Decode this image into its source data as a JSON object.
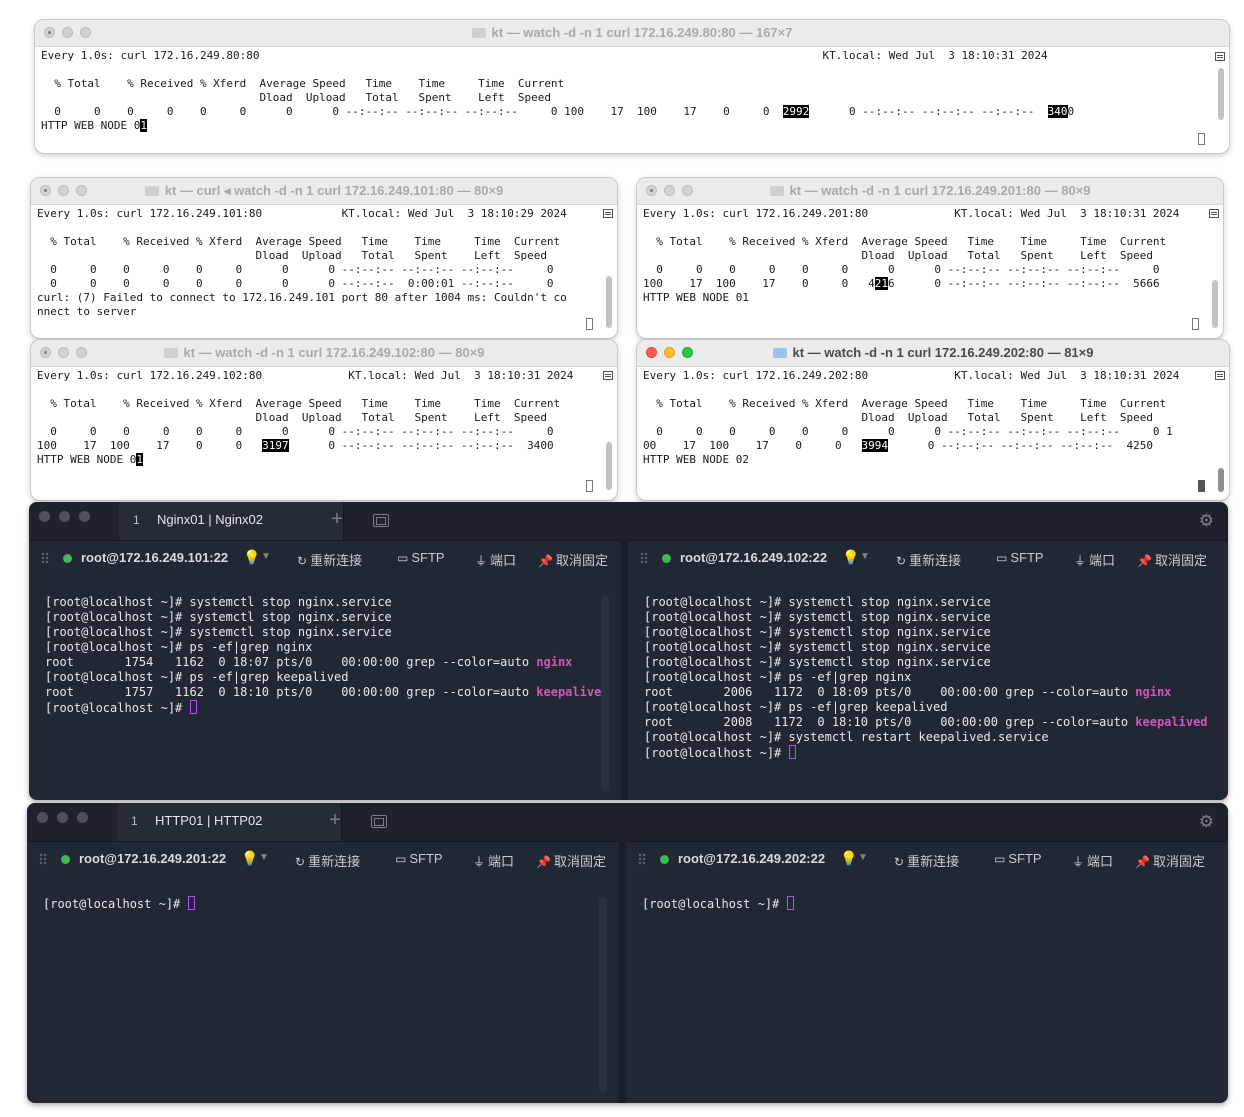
{
  "windows": {
    "w80": {
      "title": "kt — watch -d -n 1 curl 172.16.249.80:80 — 167×7",
      "lines": [
        "Every 1.0s: curl 172.16.249.80:80                                                                                     KT.local: Wed Jul  3 18:10:31 2024",
        "",
        "  % Total    % Received % Xferd  Average Speed   Time    Time     Time  Current",
        "                                 Dload  Upload   Total   Spent    Left  Speed",
        "  0     0    0     0    0     0      0      0 --:--:-- --:--:-- --:--:--     0 100    17  100    17    0     0  ",
        "HTTP WEB NODE 0"
      ],
      "hl1": "2992",
      "tail1": "      0 --:--:-- --:--:-- --:--:--  ",
      "hl2": "340",
      "tail2": "0",
      "cursor_char": "1"
    },
    "w101": {
      "title": "kt — curl ◂ watch -d -n 1 curl 172.16.249.101:80 — 80×9",
      "lines": [
        "Every 1.0s: curl 172.16.249.101:80            KT.local: Wed Jul  3 18:10:29 2024",
        "",
        "  % Total    % Received % Xferd  Average Speed   Time    Time     Time  Current",
        "                                 Dload  Upload   Total   Spent    Left  Speed",
        "  0     0    0     0    0     0      0      0 --:--:-- --:--:-- --:--:--     0",
        "  0     0    0     0    0     0      0      0 --:--:--  0:00:01 --:--:--     0",
        "curl: (7) Failed to connect to 172.16.249.101 port 80 after 1004 ms: Couldn't co",
        "nnect to server"
      ]
    },
    "w201": {
      "title": "kt — watch -d -n 1 curl 172.16.249.201:80 — 80×9",
      "lines": [
        "Every 1.0s: curl 172.16.249.201:80             KT.local: Wed Jul  3 18:10:31 2024",
        "",
        "  % Total    % Received % Xferd  Average Speed   Time    Time     Time  Current",
        "                                 Dload  Upload   Total   Spent    Left  Speed",
        "  0     0    0     0    0     0      0      0 --:--:-- --:--:-- --:--:--     0",
        "HTTP WEB NODE 01"
      ],
      "row2_pre": "100    17  100    17    0     0   4",
      "hl": "21",
      "row2_post": "6      0 --:--:-- --:--:-- --:--:--  5666"
    },
    "w102": {
      "title": "kt — watch -d -n 1 curl 172.16.249.102:80 — 80×9",
      "lines": [
        "Every 1.0s: curl 172.16.249.102:80             KT.local: Wed Jul  3 18:10:31 2024",
        "",
        "  % Total    % Received % Xferd  Average Speed   Time    Time     Time  Current",
        "                                 Dload  Upload   Total   Spent    Left  Speed",
        "  0     0    0     0    0     0      0      0 --:--:-- --:--:-- --:--:--     0",
        "HTTP WEB NODE 0"
      ],
      "row2_pre": "100    17  100    17    0     0   ",
      "hl": "3197",
      "row2_post": "      0 --:--:-- --:--:-- --:--:--  3400",
      "cursor_char": "1"
    },
    "w202": {
      "title": "kt — watch -d -n 1 curl 172.16.249.202:80 — 81×9",
      "lines": [
        "Every 1.0s: curl 172.16.249.202:80             KT.local: Wed Jul  3 18:10:31 2024",
        "",
        "  % Total    % Received % Xferd  Average Speed   Time    Time     Time  Current",
        "                                 Dload  Upload   Total   Spent    Left  Speed",
        "  0     0    0     0    0     0      0      0 --:--:-- --:--:-- --:--:--     0 1",
        "HTTP WEB NODE 02"
      ],
      "row2_pre": "00    17  100    17    0     0   ",
      "hl": "3994",
      "row2_post": "      0 --:--:-- --:--:-- --:--:--  4250"
    }
  },
  "ssh1": {
    "tab_num": "1",
    "tab_name": "Nginx01 | Nginx02",
    "left": {
      "host": "root@172.16.249.101:22",
      "lines": [
        "[root@localhost ~]# systemctl stop nginx.service",
        "[root@localhost ~]# systemctl stop nginx.service",
        "[root@localhost ~]# systemctl stop nginx.service",
        "[root@localhost ~]# ps -ef|grep nginx",
        "root       1754   1162  0 18:07 pts/0    00:00:00 grep --color=auto ",
        "[root@localhost ~]# ps -ef|grep keepalived",
        "root       1757   1162  0 18:10 pts/0    00:00:00 grep --color=auto ",
        "[root@localhost ~]# "
      ],
      "match1": "nginx",
      "match2": "keepalived"
    },
    "right": {
      "host": "root@172.16.249.102:22",
      "lines": [
        "[root@localhost ~]# systemctl stop nginx.service",
        "[root@localhost ~]# systemctl stop nginx.service",
        "[root@localhost ~]# systemctl stop nginx.service",
        "[root@localhost ~]# systemctl stop nginx.service",
        "[root@localhost ~]# systemctl stop nginx.service",
        "[root@localhost ~]# ps -ef|grep nginx",
        "root       2006   1172  0 18:09 pts/0    00:00:00 grep --color=auto ",
        "[root@localhost ~]# ps -ef|grep keepalived",
        "root       2008   1172  0 18:10 pts/0    00:00:00 grep --color=auto ",
        "[root@localhost ~]# systemctl restart keepalived.service",
        "[root@localhost ~]# "
      ],
      "match1": "nginx",
      "match2": "keepalived"
    }
  },
  "ssh2": {
    "tab_num": "1",
    "tab_name": "HTTP01 | HTTP02",
    "left": {
      "host": "root@172.16.249.201:22",
      "lines": [
        "[root@localhost ~]# "
      ]
    },
    "right": {
      "host": "root@172.16.249.202:22",
      "lines": [
        "[root@localhost ~]# "
      ]
    }
  },
  "actions": {
    "reconnect": "重新连接",
    "sftp": "SFTP",
    "port": "端口",
    "unpin": "取消固定"
  },
  "icons": {
    "reconnect": "refresh-icon",
    "sftp": "folder-icon",
    "port": "plug-icon",
    "unpin": "pin-icon",
    "gear": "gear-icon"
  }
}
